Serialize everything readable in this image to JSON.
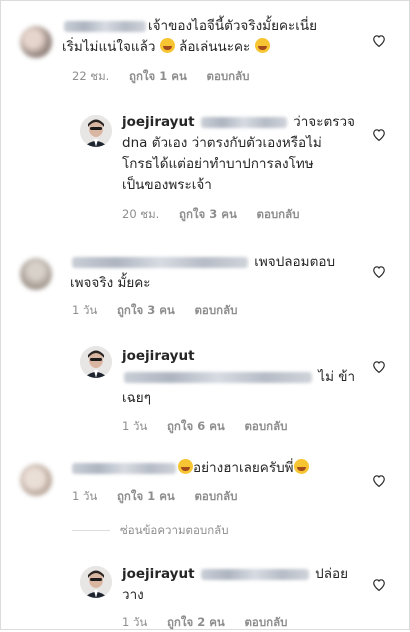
{
  "comments": [
    {
      "line1": "เจ้าของไอจีนี้ตัวจริงมั้ยคะเนี่ย",
      "line2": "เริ่มไม่แน่ใจแล้ว",
      "line2_b": "ล้อเล่นนะคะ",
      "time": "22 ชม.",
      "likes": "ถูกใจ 1 คน",
      "reply": "ตอบกลับ"
    },
    {
      "username": "joejirayut",
      "line1_tail": "ว่าจะตรวจ",
      "line2": "dna ตัวเอง ว่าตรงกับตัวเองหรือไม่",
      "line3": "โกรธได้แต่อย่าทำบาปการลงโทษ",
      "line4": "เป็นของพระเจ้า",
      "time": "20 ชม.",
      "likes": "ถูกใจ 3 คน",
      "reply": "ตอบกลับ"
    },
    {
      "line1_tail": "เพจปลอมตอบ",
      "line2": "เพจจริง มั้ยคะ",
      "time": "1 วัน",
      "likes": "ถูกใจ 3 คน",
      "reply": "ตอบกลับ"
    },
    {
      "username": "joejirayut",
      "line2_tail": "ไม่ ข้า",
      "line3": "เฉยๆ",
      "time": "1 วัน",
      "likes": "ถูกใจ 6 คน",
      "reply": "ตอบกลับ"
    },
    {
      "line1_tail": "อย่างฮาเลยครับพี่",
      "time": "1 วัน",
      "likes": "ถูกใจ 1 คน",
      "reply": "ตอบกลับ"
    },
    {
      "username": "joejirayut",
      "line1_tail": "ปล่อย",
      "line2": "วาง",
      "time": "1 วัน",
      "likes": "ถูกใจ 2 คน",
      "reply": "ตอบกลับ"
    }
  ],
  "hide_replies": "ซ่อนข้อความตอบกลับ",
  "icons": {
    "like": "heart-outline-icon",
    "emoji_yum": "face-savoring-food-emoji",
    "emoji_laugh": "rolling-on-floor-laughing-emoji"
  },
  "colors": {
    "text": "#262626",
    "meta": "#8e8e8e",
    "divider": "#dbdbdb"
  }
}
